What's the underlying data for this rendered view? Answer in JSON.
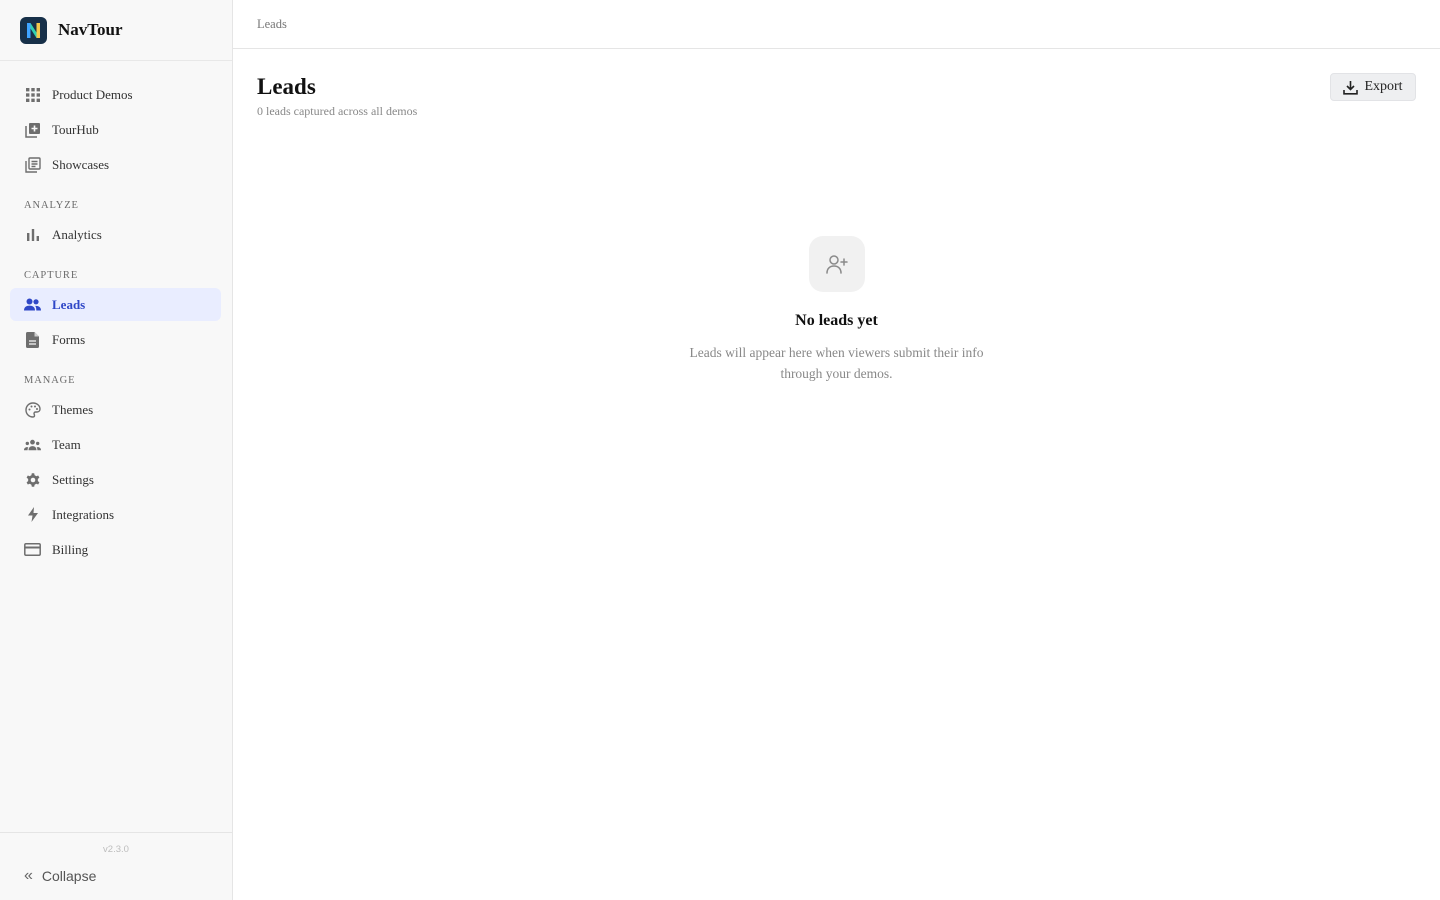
{
  "brand": {
    "name": "NavTour",
    "logo_letter": "N"
  },
  "nav": {
    "primary": [
      {
        "label": "Product Demos",
        "icon": "grid-icon"
      },
      {
        "label": "TourHub",
        "icon": "add-box-icon"
      },
      {
        "label": "Showcases",
        "icon": "library-icon"
      }
    ],
    "analyze_label": "ANALYZE",
    "analyze": [
      {
        "label": "Analytics",
        "icon": "bar-chart-icon"
      }
    ],
    "capture_label": "CAPTURE",
    "capture": [
      {
        "label": "Leads",
        "icon": "people-icon",
        "active": true
      },
      {
        "label": "Forms",
        "icon": "document-icon"
      }
    ],
    "manage_label": "MANAGE",
    "manage": [
      {
        "label": "Themes",
        "icon": "palette-icon"
      },
      {
        "label": "Team",
        "icon": "group-icon"
      },
      {
        "label": "Settings",
        "icon": "gear-icon"
      },
      {
        "label": "Integrations",
        "icon": "lightning-icon"
      },
      {
        "label": "Billing",
        "icon": "credit-card-icon"
      }
    ]
  },
  "footer": {
    "version": "v2.3.0",
    "collapse_label": "Collapse"
  },
  "breadcrumb": {
    "current": "Leads"
  },
  "header": {
    "title": "Leads",
    "subtitle": "0 leads captured across all demos",
    "export_label": "Export"
  },
  "empty_state": {
    "title": "No leads yet",
    "message": "Leads will appear here when viewers submit their info through your demos."
  },
  "colors": {
    "accent": "#2f47c7",
    "active_bg": "#e9edff",
    "logo_bg": "#173049",
    "icon_gray": "#6e6e6e"
  }
}
